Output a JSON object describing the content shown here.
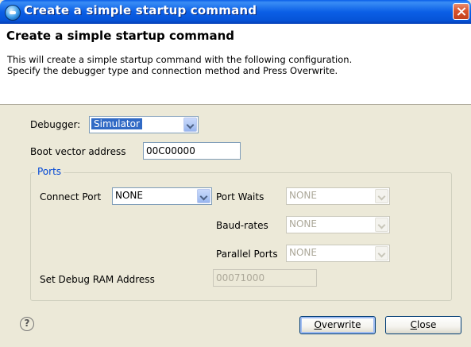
{
  "window": {
    "title": "Create a simple startup command"
  },
  "header": {
    "title": "Create a simple startup command",
    "description_line1": "This will create a simple startup command with the following configuration.",
    "description_line2": "Specify the debugger type and connection method and Press Overwrite."
  },
  "form": {
    "debugger_label": "Debugger:",
    "debugger_value": "Simulator",
    "boot_vector_label": "Boot vector address",
    "boot_vector_value": "00C00000",
    "ports_group_label": "Ports",
    "connect_port_label": "Connect Port",
    "connect_port_value": "NONE",
    "port_waits_label": "Port Waits",
    "port_waits_value": "NONE",
    "baud_rates_label": "Baud-rates",
    "baud_rates_value": "NONE",
    "parallel_ports_label": "Parallel Ports",
    "parallel_ports_value": "NONE",
    "debug_ram_label": "Set Debug RAM Address",
    "debug_ram_value": "00071000"
  },
  "buttons": {
    "overwrite_mnemonic": "O",
    "overwrite_rest": "verwrite",
    "close_mnemonic": "C",
    "close_rest": "lose"
  },
  "icons": {
    "app": "app-icon",
    "close": "close-icon",
    "help": "help-icon",
    "help_glyph": "?"
  },
  "colors": {
    "titlebar": "#0a5ee8",
    "accent": "#316ac5",
    "group_label": "#0046d5"
  }
}
